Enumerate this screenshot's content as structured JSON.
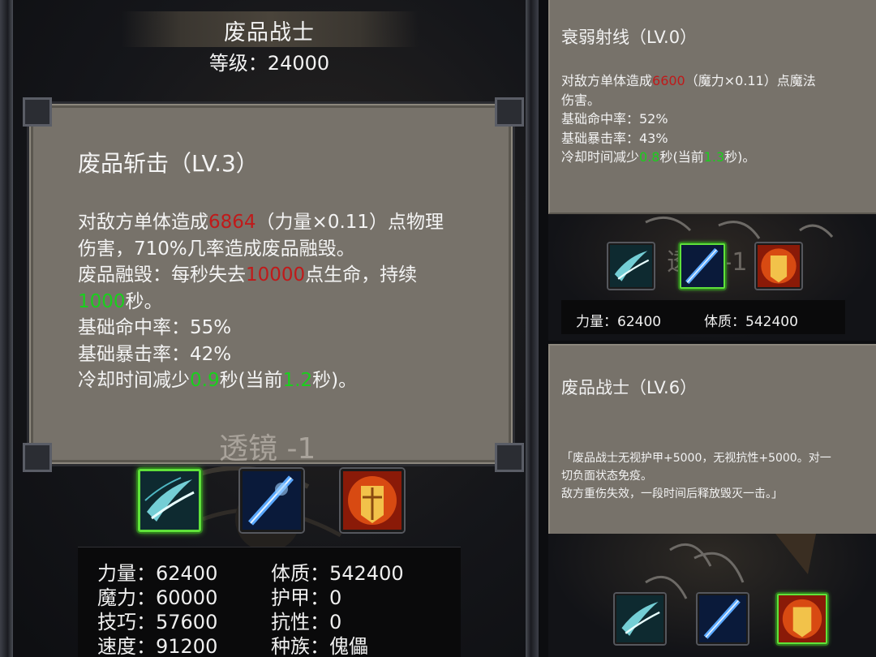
{
  "hero": {
    "name": "废品战士",
    "level": "等级：24000"
  },
  "left_skill": {
    "title": "废品斩击（LV.3）",
    "lines": [
      {
        "parts": [
          {
            "t": "对敌方单体造成"
          },
          {
            "t": "6864",
            "c": "red"
          },
          {
            "t": "（力量×0.11）点物理"
          }
        ]
      },
      {
        "parts": [
          {
            "t": "伤害，710%几率造成废品融毁。"
          }
        ]
      },
      {
        "parts": [
          {
            "t": "废品融毁：每秒失去"
          },
          {
            "t": "10000",
            "c": "red"
          },
          {
            "t": "点生命，持续"
          }
        ]
      },
      {
        "parts": [
          {
            "t": "1000",
            "c": "green"
          },
          {
            "t": "秒。"
          }
        ]
      },
      {
        "parts": [
          {
            "t": "基础命中率：55%"
          }
        ]
      },
      {
        "parts": [
          {
            "t": "基础暴击率：42%"
          }
        ]
      },
      {
        "parts": [
          {
            "t": "冷却时间减少"
          },
          {
            "t": "0.9",
            "c": "green"
          },
          {
            "t": "秒(当前"
          },
          {
            "t": "1.2",
            "c": "green"
          },
          {
            "t": "秒)。"
          }
        ]
      }
    ],
    "watermark": "透镜 -1"
  },
  "skill_icons": [
    {
      "name": "slash-skill-icon",
      "selected": true
    },
    {
      "name": "blue-ray-skill-icon",
      "selected": false
    },
    {
      "name": "golden-armor-skill-icon",
      "selected": false
    }
  ],
  "stats": {
    "left_col": [
      "力量：62400",
      "魔力：60000",
      "技巧：57600",
      "速度：91200"
    ],
    "right_col": [
      "体质：542400",
      "护甲：0",
      "抗性：0",
      "种族：傀儡"
    ]
  },
  "right_top_skill": {
    "title": "衰弱射线（LV.0）",
    "lines": [
      {
        "parts": [
          {
            "t": "对敌方单体造成"
          },
          {
            "t": "6600",
            "c": "red"
          },
          {
            "t": "（魔力×0.11）点魔法"
          }
        ]
      },
      {
        "parts": [
          {
            "t": "伤害。"
          }
        ]
      },
      {
        "parts": [
          {
            "t": "基础命中率：52%"
          }
        ]
      },
      {
        "parts": [
          {
            "t": "基础暴击率：43%"
          }
        ]
      },
      {
        "parts": [
          {
            "t": "冷却时间减少"
          },
          {
            "t": "0.8",
            "c": "green"
          },
          {
            "t": "秒(当前"
          },
          {
            "t": "1.3",
            "c": "green"
          },
          {
            "t": "秒)。"
          }
        ]
      }
    ]
  },
  "right_mid": {
    "watermark": "透镜 -1",
    "stats": [
      "力量：62400",
      "体质：542400"
    ]
  },
  "right_bottom_skill": {
    "title": "废品战士（LV.6）",
    "lines": [
      "「废品战士无视护甲+5000，无视抗性+5000。对一",
      "切负面状态免疫。",
      "敌方重伤失效，一段时间后释放毁灭一击。」"
    ]
  },
  "colors": {
    "panel": "#77726a",
    "damage_red": "#c01a1a",
    "bonus_green": "#19d01c",
    "select_green": "#5fe23a"
  }
}
